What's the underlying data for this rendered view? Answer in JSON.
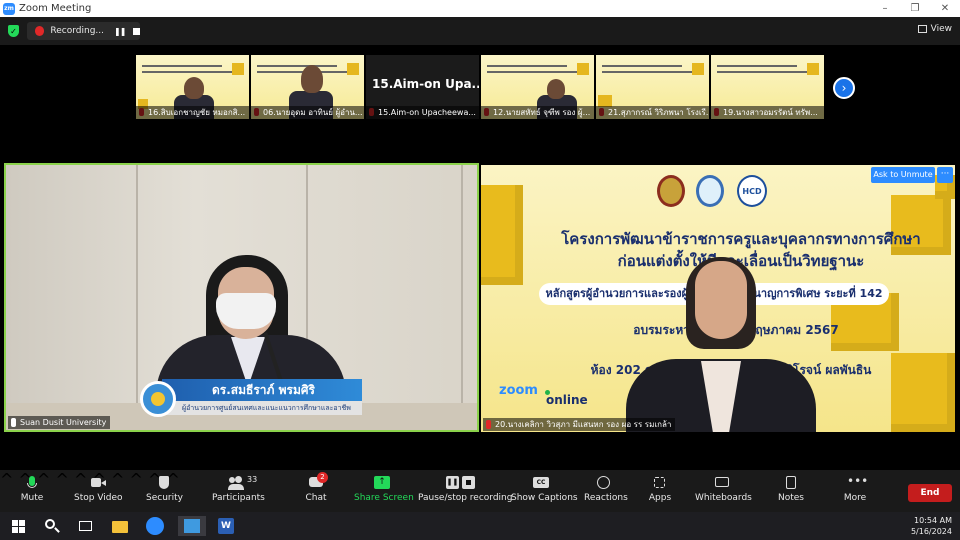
{
  "window": {
    "title": "Zoom Meeting",
    "controls": [
      "–",
      "❐",
      "✕"
    ]
  },
  "topbar": {
    "recording_label": "Recording...",
    "pause_symbol": "❚❚",
    "view_label": "View"
  },
  "thumbnails": [
    {
      "name": "16.สิบเอกชาญชัย หมอกสิ..."
    },
    {
      "name": "06.นายอุดม อาทินย์ ผู้อำน..."
    },
    {
      "name": "15.Aim-on Upacheewa...",
      "big_text": "15.Aim-on Upa..."
    },
    {
      "name": "12.นายสหัทธ์ จุฑีพ รอง ผู้..."
    },
    {
      "name": "21.สุภากรณ์ วิริภพนา โรงเรี..."
    },
    {
      "name": "19.นางสาวอมรรัตน์ ทรัพ..."
    }
  ],
  "left_tile": {
    "name_card": {
      "name": "ดร.สมธีราภ์ พรมศิริ",
      "position": "ผู้อำนวยการศูนย์สนเทศและแนะแนวการศึกษาและอาชีพ"
    },
    "label": "Suan Dusit University"
  },
  "right_tile": {
    "ask_unmute": "Ask to Unmute",
    "more": "···",
    "slide": {
      "logo3": "HCD",
      "title1": "โครงการพัฒนาข้าราชการครูและบุคลากรทางการศึกษา",
      "title2": "ก่อนแต่งตั้งให้มีและเลื่อนเป็นวิทยฐานะ",
      "course": "หลักสูตรผู้อำนวยการและรองผู้อำนวยการชำนาญการพิเศษ ระยะที่ 142",
      "date": "อบรมระหว่างวันที่ ... พฤษภาคม 2567",
      "room": "ห้อง 202 ศูนย์พัฒนาบุคลากร ... ดร ศิโรจน์ ผลพันธิน",
      "zoom_word": "zoom",
      "online_word": "online"
    },
    "label": "20.นางเคลิกา วิวสุภา มีแสนหก รอง ผอ รร รมเกล้า"
  },
  "toolbar": {
    "mute": "Mute",
    "stop_video": "Stop Video",
    "security": "Security",
    "participants": "Participants",
    "participants_count": "33",
    "chat": "Chat",
    "chat_badge": "2",
    "share_screen": "Share Screen",
    "pause_recording": "Pause/stop recording",
    "captions": "Show Captions",
    "captions_icon": "CC",
    "reactions": "Reactions",
    "apps": "Apps",
    "whiteboards": "Whiteboards",
    "notes": "Notes",
    "more": "More",
    "end": "End"
  },
  "taskbar": {
    "time": "10:54 AM",
    "date": "5/16/2024"
  },
  "colors": {
    "zoom_blue": "#2d8cff",
    "active_speaker": "#8bd24b",
    "end_red": "#c41d1d",
    "share_green": "#23d959"
  }
}
